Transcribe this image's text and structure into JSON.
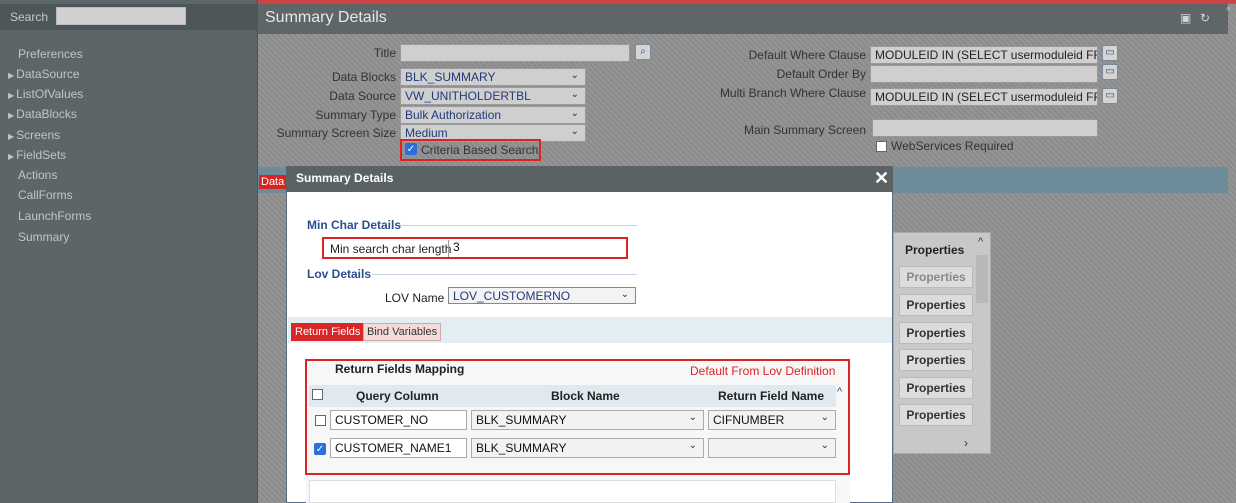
{
  "sidebar": {
    "search_label": "Search",
    "items": [
      {
        "label": "Preferences",
        "expandable": false
      },
      {
        "label": "DataSource",
        "expandable": true
      },
      {
        "label": "ListOfValues",
        "expandable": true
      },
      {
        "label": "DataBlocks",
        "expandable": true
      },
      {
        "label": "Screens",
        "expandable": true
      },
      {
        "label": "FieldSets",
        "expandable": true
      },
      {
        "label": "Actions",
        "expandable": false
      },
      {
        "label": "CallForms",
        "expandable": false
      },
      {
        "label": "LaunchForms",
        "expandable": false
      },
      {
        "label": "Summary",
        "expandable": false
      }
    ]
  },
  "header": {
    "title": "Summary Details"
  },
  "form": {
    "title_label": "Title",
    "title_value": "",
    "data_blocks_label": "Data Blocks",
    "data_blocks_value": "BLK_SUMMARY",
    "data_source_label": "Data Source",
    "data_source_value": "VW_UNITHOLDERTBL",
    "summary_type_label": "Summary Type",
    "summary_type_value": "Bulk Authorization",
    "screen_size_label": "Summary Screen Size",
    "screen_size_value": "Medium",
    "criteria_label": "Criteria Based Search",
    "criteria_checked": true,
    "where_label": "Default Where Clause",
    "where_value": "MODULEID IN (SELECT usermoduleid FROM T",
    "order_label": "Default Order By",
    "order_value": "",
    "multi_where_label": "Multi Branch Where Clause",
    "multi_where_value": "MODULEID IN (SELECT usermoduleid FROM T",
    "main_summary_label": "Main Summary Screen",
    "main_summary_value": "",
    "webservices_label": "WebServices Required",
    "tab_data": "Data"
  },
  "properties_buttons": [
    "Properties",
    "Properties",
    "Properties",
    "Properties",
    "Properties",
    "Properties",
    "Properties"
  ],
  "properties_header": "Properties",
  "dialog": {
    "title": "Summary Details",
    "close": "✕",
    "min_char_section": "Min Char Details",
    "min_search_label": "Min search char length",
    "min_search_value": "3",
    "lov_section": "Lov Details",
    "lov_name_label": "LOV Name",
    "lov_name_value": "LOV_CUSTOMERNO",
    "tabs": {
      "return_fields": "Return Fields",
      "bind_variables": "Bind Variables"
    },
    "mapping_title": "Return Fields Mapping",
    "default_note": "Default From Lov Definition",
    "columns": [
      "Query Column",
      "Block Name",
      "Return Field Name"
    ],
    "rows": [
      {
        "checked": false,
        "query": "CUSTOMER_NO",
        "block": "BLK_SUMMARY",
        "return_field": "CIFNUMBER"
      },
      {
        "checked": true,
        "query": "CUSTOMER_NAME1",
        "block": "BLK_SUMMARY",
        "return_field": ""
      }
    ]
  },
  "colors": {
    "accent_red": "#d22222",
    "dialog_header": "#5a6263",
    "link_blue": "#2a4f8f"
  }
}
